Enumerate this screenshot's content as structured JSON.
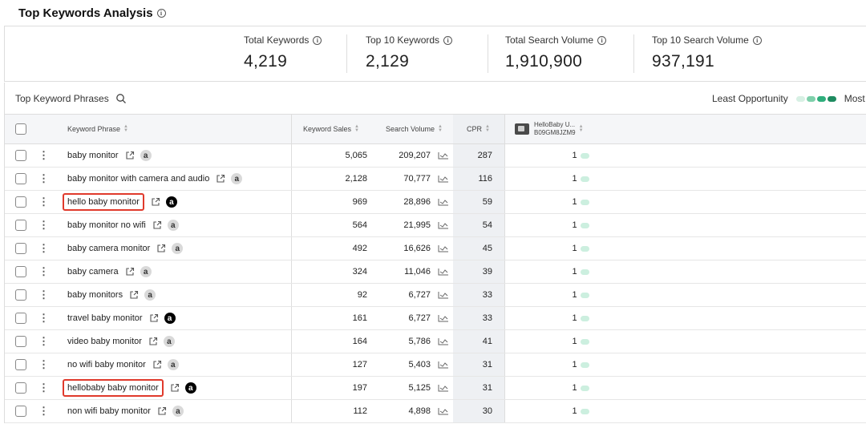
{
  "header": {
    "title": "Top Keywords Analysis"
  },
  "summary": {
    "metrics": [
      {
        "label": "Total Keywords",
        "value": "4,219"
      },
      {
        "label": "Top 10 Keywords",
        "value": "2,129"
      },
      {
        "label": "Total Search Volume",
        "value": "1,910,900"
      },
      {
        "label": "Top 10 Search Volume",
        "value": "937,191"
      }
    ]
  },
  "toolbar": {
    "section_label": "Top Keyword Phrases"
  },
  "legend": {
    "least": "Least Opportunity",
    "most": "Most",
    "colors": [
      "#d7f0e4",
      "#7fd0ab",
      "#2fae7c",
      "#1e8b60"
    ]
  },
  "table": {
    "headers": {
      "keyword": "Keyword Phrase",
      "sales": "Keyword Sales",
      "volume": "Search Volume",
      "cpr": "CPR",
      "product_name": "HelloBaby U...",
      "product_asin": "B09GM8JZM9"
    },
    "rows": [
      {
        "keyword": "baby monitor",
        "sales": "5,065",
        "volume": "209,207",
        "cpr": "287",
        "rank": "1",
        "amazon": "grey",
        "highlighted": false
      },
      {
        "keyword": "baby monitor with camera and audio",
        "sales": "2,128",
        "volume": "70,777",
        "cpr": "116",
        "rank": "1",
        "amazon": "grey",
        "highlighted": false
      },
      {
        "keyword": "hello baby monitor",
        "sales": "969",
        "volume": "28,896",
        "cpr": "59",
        "rank": "1",
        "amazon": "black",
        "highlighted": true
      },
      {
        "keyword": "baby monitor no wifi",
        "sales": "564",
        "volume": "21,995",
        "cpr": "54",
        "rank": "1",
        "amazon": "grey",
        "highlighted": false
      },
      {
        "keyword": "baby camera monitor",
        "sales": "492",
        "volume": "16,626",
        "cpr": "45",
        "rank": "1",
        "amazon": "grey",
        "highlighted": false
      },
      {
        "keyword": "baby camera",
        "sales": "324",
        "volume": "11,046",
        "cpr": "39",
        "rank": "1",
        "amazon": "grey",
        "highlighted": false
      },
      {
        "keyword": "baby monitors",
        "sales": "92",
        "volume": "6,727",
        "cpr": "33",
        "rank": "1",
        "amazon": "grey",
        "highlighted": false
      },
      {
        "keyword": "travel baby monitor",
        "sales": "161",
        "volume": "6,727",
        "cpr": "33",
        "rank": "1",
        "amazon": "black",
        "highlighted": false
      },
      {
        "keyword": "video baby monitor",
        "sales": "164",
        "volume": "5,786",
        "cpr": "41",
        "rank": "1",
        "amazon": "grey",
        "highlighted": false
      },
      {
        "keyword": "no wifi baby monitor",
        "sales": "127",
        "volume": "5,403",
        "cpr": "31",
        "rank": "1",
        "amazon": "grey",
        "highlighted": false
      },
      {
        "keyword": "hellobaby baby monitor",
        "sales": "197",
        "volume": "5,125",
        "cpr": "31",
        "rank": "1",
        "amazon": "black",
        "highlighted": true
      },
      {
        "keyword": "non wifi baby monitor",
        "sales": "112",
        "volume": "4,898",
        "cpr": "30",
        "rank": "1",
        "amazon": "grey",
        "highlighted": false
      }
    ]
  },
  "colors": {
    "highlight": "#e03a2c",
    "rank_pill": "#ccefdf"
  },
  "icons": {
    "amazon_glyph": "a"
  }
}
